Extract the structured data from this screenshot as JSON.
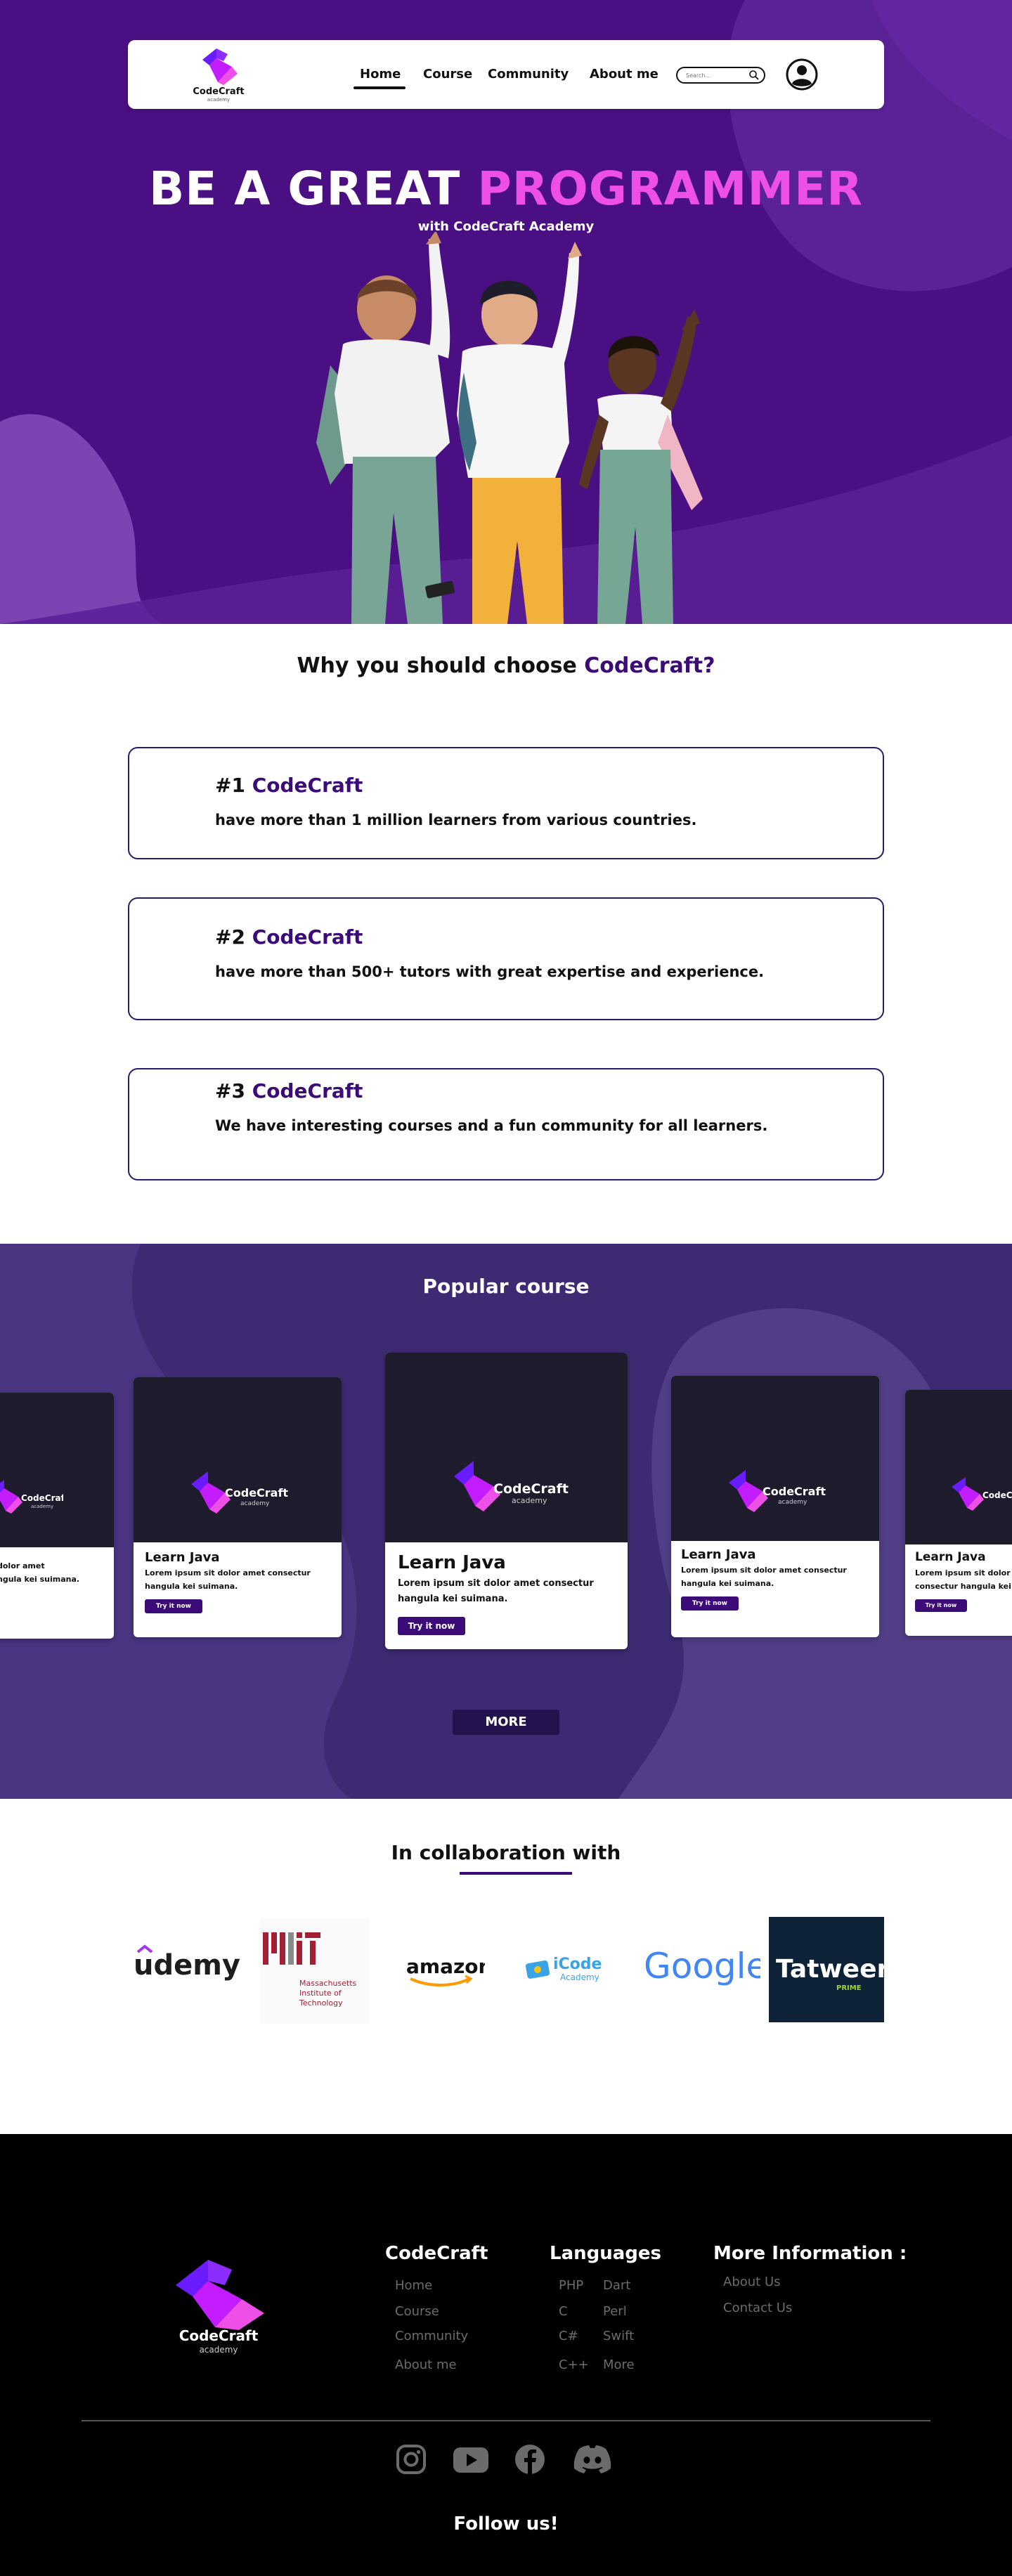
{
  "nav": {
    "brand": "CodeCraft",
    "brand_sub": "academy",
    "links": [
      "Home",
      "Course",
      "Community",
      "About me"
    ],
    "search_placeholder": "Search..."
  },
  "hero": {
    "title_main": "BE A GREAT ",
    "title_accent": "PROGRAMMER",
    "subtitle": "with CodeCraft Academy"
  },
  "why": {
    "title_main": "Why you should choose ",
    "title_accent": "CodeCraft?",
    "cards": [
      {
        "rank": "#1 ",
        "brand": "CodeCraft",
        "text": "have more than 1 million learners from various countries."
      },
      {
        "rank": "#2 ",
        "brand": "CodeCraft",
        "text": "have more than 500+ tutors with great expertise and experience."
      },
      {
        "rank": "#3 ",
        "brand": "CodeCraft",
        "text": "We have interesting courses and a fun community for all learners."
      }
    ]
  },
  "popular": {
    "title": "Popular course",
    "course": {
      "logo_brand": "CodeCraft",
      "logo_sub": "academy",
      "name": "Learn Java",
      "desc_line1": "Lorem ipsum sit dolor amet consectur",
      "desc_line2": "hangula kei suimana.",
      "left_partial_line1": "dolor amet",
      "left_partial_line2": "ngula kei suimana.",
      "right_partial_line1": "Lorem ipsum sit dolor amet",
      "right_partial_line2": "consectur hangula kei",
      "button": "Try it now"
    },
    "more_button": "MORE"
  },
  "collab": {
    "title": "In collaboration with",
    "partners": [
      "udemy",
      "Massachusetts",
      "Institute of",
      "Technology",
      "amazon",
      "iCode",
      "Academy",
      "Google",
      "Tatweer",
      "PRIME"
    ]
  },
  "footer": {
    "brand": "CodeCraft",
    "brand_sub": "academy",
    "col1_title": "CodeCraft",
    "col1_links": [
      "Home",
      "Course",
      "Community",
      "About me"
    ],
    "col2_title": "Languages",
    "col2_links_a": [
      "PHP",
      "C",
      "C#",
      "C++"
    ],
    "col2_links_b": [
      "Dart",
      "Perl",
      "Swift",
      "More"
    ],
    "col3_title": "More Information :",
    "col3_links": [
      "About Us",
      "Contact Us"
    ],
    "follow": "Follow us!"
  },
  "colors": {
    "primary": "#4a0f82",
    "accent": "#ee4fe6",
    "popular_bg": "#3d2a72",
    "footer_bg": "#000000"
  }
}
